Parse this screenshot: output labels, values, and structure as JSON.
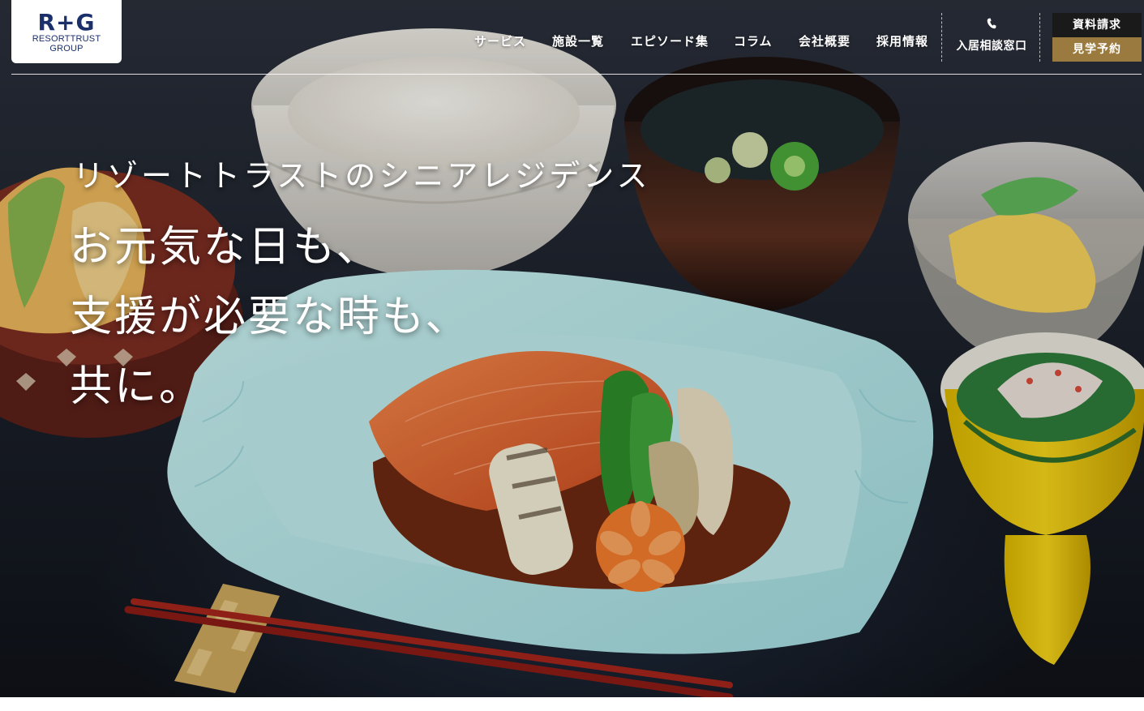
{
  "logo": {
    "mark": "R+G",
    "line1": "RESORTTRUST",
    "line2": "GROUP"
  },
  "nav": {
    "items": [
      "サービス",
      "施設一覧",
      "エピソード集",
      "コラム",
      "会社概要",
      "採用情報"
    ]
  },
  "consult": {
    "icon": "phone-icon",
    "label": "入居相談窓口"
  },
  "buttons": {
    "document_request": "資料請求",
    "visit_reservation": "見学予約"
  },
  "hero": {
    "tagline": "リゾートトラストのシニアレジデンス",
    "headline_lines": [
      "お元気な日も、",
      "支援が必要な時も、",
      "共に。"
    ]
  },
  "colors": {
    "brand_navy": "#1b2f6b",
    "document_button": "#1a1a1a",
    "visit_button": "#9a7a3e"
  }
}
